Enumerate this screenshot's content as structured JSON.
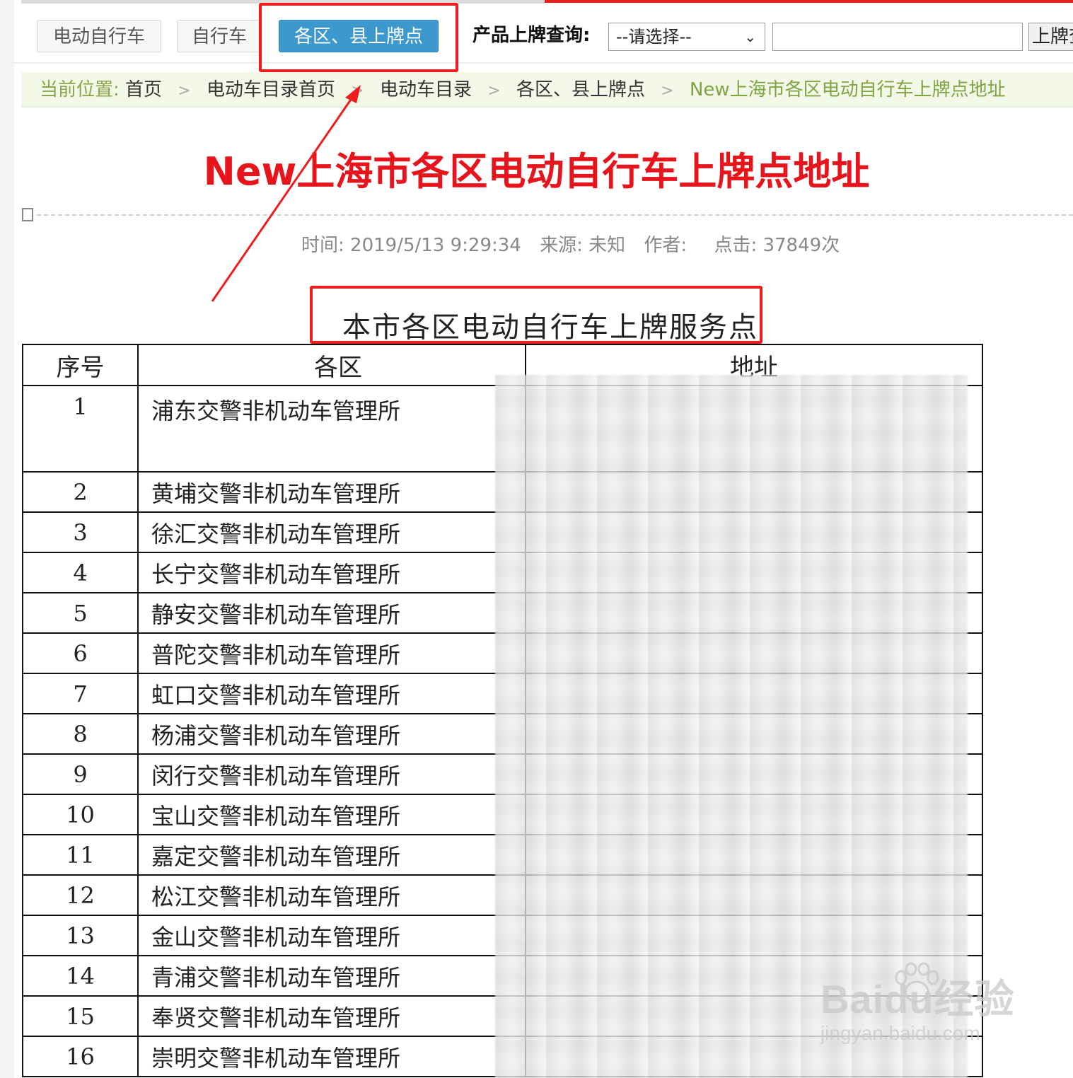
{
  "nav": {
    "tabs": [
      {
        "label": "电动自行车"
      },
      {
        "label": "自行车"
      },
      {
        "label": "各区、县上牌点",
        "active": true
      }
    ],
    "query_label": "产品上牌查询:",
    "select_value": "--请选择--",
    "input_value": "",
    "query_button": "上牌查"
  },
  "breadcrumb": {
    "lead": "当前位置:",
    "items": [
      "首页",
      "电动车目录首页",
      "电动车目录",
      "各区、县上牌点"
    ],
    "current": "New上海市各区电动自行车上牌点地址"
  },
  "article": {
    "title": "New上海市各区电动自行车上牌点地址",
    "meta": {
      "time": "时间: 2019/5/13 9:29:34",
      "source": "来源: 未知",
      "author": "作者:",
      "hits": "点击: 37849次"
    }
  },
  "table": {
    "heading": "本市各区电动自行车上牌服务点",
    "headers": [
      "序号",
      "各区",
      "地址"
    ],
    "rows": [
      {
        "no": "1",
        "name": "浦东交警非机动车管理所"
      },
      {
        "no": "2",
        "name": "黄埔交警非机动车管理所"
      },
      {
        "no": "3",
        "name": "徐汇交警非机动车管理所"
      },
      {
        "no": "4",
        "name": "长宁交警非机动车管理所"
      },
      {
        "no": "5",
        "name": "静安交警非机动车管理所"
      },
      {
        "no": "6",
        "name": "普陀交警非机动车管理所"
      },
      {
        "no": "7",
        "name": "虹口交警非机动车管理所"
      },
      {
        "no": "8",
        "name": "杨浦交警非机动车管理所"
      },
      {
        "no": "9",
        "name": "闵行交警非机动车管理所"
      },
      {
        "no": "10",
        "name": "宝山交警非机动车管理所"
      },
      {
        "no": "11",
        "name": "嘉定交警非机动车管理所"
      },
      {
        "no": "12",
        "name": "松江交警非机动车管理所"
      },
      {
        "no": "13",
        "name": "金山交警非机动车管理所"
      },
      {
        "no": "14",
        "name": "青浦交警非机动车管理所"
      },
      {
        "no": "15",
        "name": "奉贤交警非机动车管理所"
      },
      {
        "no": "16",
        "name": "崇明交警非机动车管理所"
      }
    ]
  },
  "watermark": {
    "brand": "Baidu经验",
    "url": "jingyan.baidu.com"
  },
  "colors": {
    "active_tab": "#3c98cd",
    "title_red": "#e8141b",
    "annotation_red": "#ee1c1c",
    "breadcrumb_bg": "#f3f8e9"
  }
}
